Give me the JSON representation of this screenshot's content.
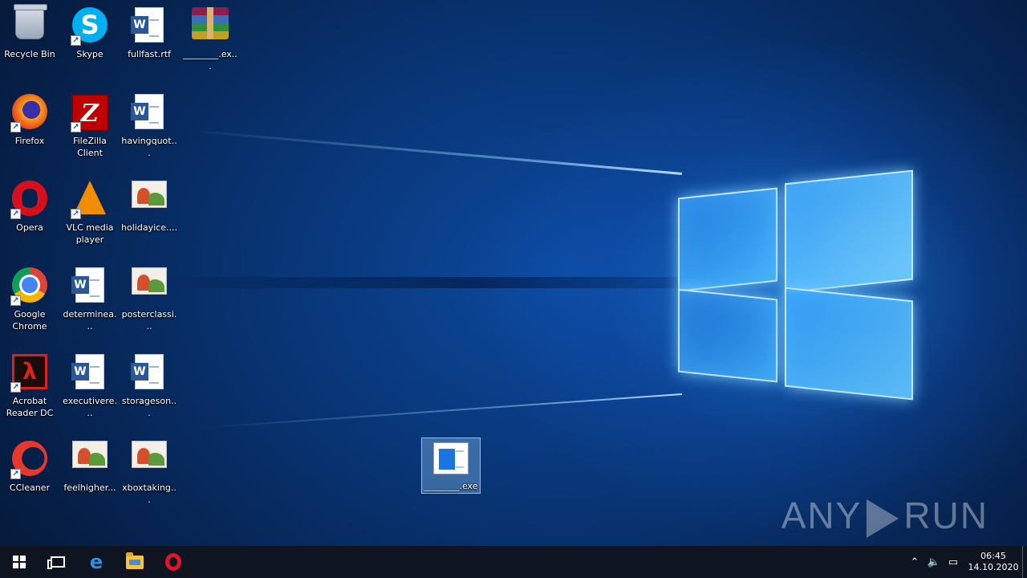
{
  "desktop_icons": [
    {
      "label": "Recycle Bin",
      "icon": "recycle-bin-icon"
    },
    {
      "label": "Skype",
      "icon": "skype-icon"
    },
    {
      "label": "fullfast.rtf",
      "icon": "word-document-icon"
    },
    {
      "label": "________.ex...",
      "icon": "winrar-archive-icon"
    },
    {
      "label": "Firefox",
      "icon": "firefox-icon"
    },
    {
      "label": "FileZilla Client",
      "icon": "filezilla-icon"
    },
    {
      "label": "havingquot...",
      "icon": "word-document-icon"
    },
    {
      "label": "Opera",
      "icon": "opera-icon"
    },
    {
      "label": "VLC media player",
      "icon": "vlc-icon"
    },
    {
      "label": "holidayice....",
      "icon": "image-file-icon"
    },
    {
      "label": "Google Chrome",
      "icon": "chrome-icon"
    },
    {
      "label": "determinea...",
      "icon": "word-document-icon"
    },
    {
      "label": "posterclassi...",
      "icon": "image-file-icon"
    },
    {
      "label": "Acrobat Reader DC",
      "icon": "acrobat-icon"
    },
    {
      "label": "executivere...",
      "icon": "word-document-icon"
    },
    {
      "label": "storageson...",
      "icon": "word-document-icon"
    },
    {
      "label": "CCleaner",
      "icon": "ccleaner-icon"
    },
    {
      "label": "feelhigher...",
      "icon": "image-file-icon"
    },
    {
      "label": "xboxtaking...",
      "icon": "image-file-icon"
    },
    {
      "label": "________.exe",
      "icon": "executable-icon"
    }
  ],
  "watermark": {
    "left": "ANY",
    "right": "RUN"
  },
  "taskbar": {
    "pinned": [
      "start-button",
      "task-view",
      "edge",
      "file-explorer",
      "opera"
    ],
    "clock_time": "06:45",
    "clock_date": "14.10.2020"
  },
  "colors": {
    "taskbar": "#0f1520",
    "accent": "#0078d7"
  }
}
